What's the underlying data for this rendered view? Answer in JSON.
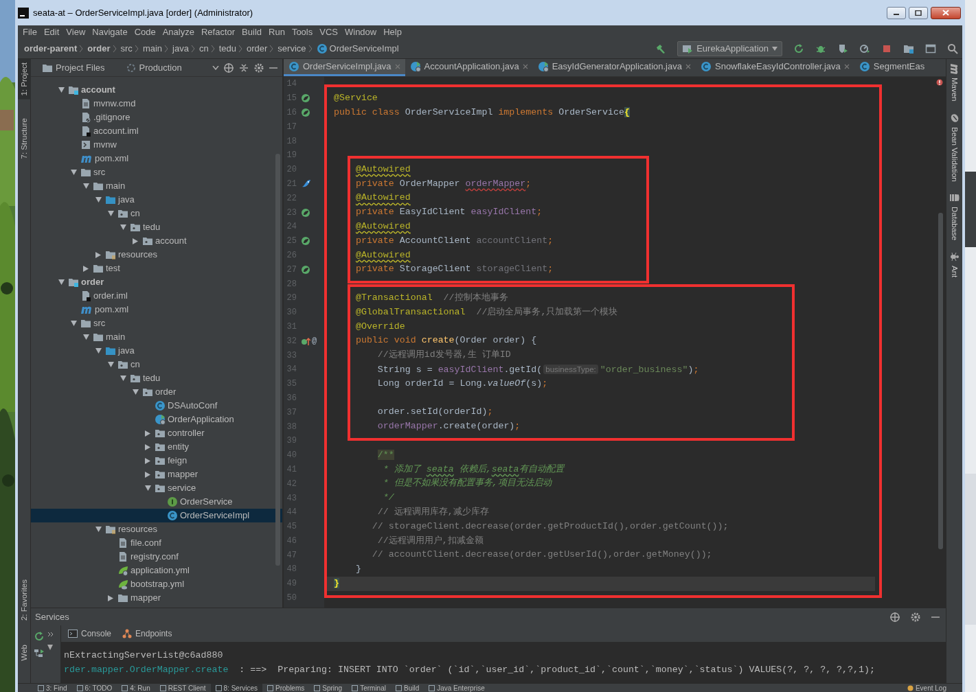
{
  "window": {
    "title": "seata-at – OrderServiceImpl.java [order] (Administrator)"
  },
  "menu": [
    "File",
    "Edit",
    "View",
    "Navigate",
    "Code",
    "Analyze",
    "Refactor",
    "Build",
    "Run",
    "Tools",
    "VCS",
    "Window",
    "Help"
  ],
  "breadcrumbs": [
    {
      "label": "order-parent",
      "kind": "module"
    },
    {
      "label": "order",
      "kind": "module"
    },
    {
      "label": "src",
      "kind": "folder"
    },
    {
      "label": "main",
      "kind": "folder"
    },
    {
      "label": "java",
      "kind": "folder"
    },
    {
      "label": "cn",
      "kind": "folder"
    },
    {
      "label": "tedu",
      "kind": "folder"
    },
    {
      "label": "order",
      "kind": "folder"
    },
    {
      "label": "service",
      "kind": "folder"
    },
    {
      "label": "OrderServiceImpl",
      "kind": "class"
    }
  ],
  "run_config": {
    "label": "EurekaApplication"
  },
  "left_strip": {
    "top": [
      {
        "label": "1: Project",
        "selected": true
      },
      {
        "label": "7: Structure",
        "selected": false
      }
    ],
    "bottom": [
      {
        "label": "2: Favorites",
        "selected": false
      },
      {
        "label": "Web",
        "selected": false
      }
    ]
  },
  "right_strip": [
    "Maven",
    "Bean Validation",
    "Database",
    "Ant"
  ],
  "project_panel": {
    "view": "Project Files",
    "scope": "Production",
    "tree": [
      {
        "label": "account",
        "kind": "module",
        "selected": false,
        "expanded": true,
        "children": [
          {
            "label": "mvnw.cmd",
            "kind": "file-text",
            "selected": false
          },
          {
            "label": ".gitignore",
            "kind": "file-ignore",
            "selected": false
          },
          {
            "label": "account.iml",
            "kind": "file-iml",
            "selected": false
          },
          {
            "label": "mvnw",
            "kind": "file-script",
            "selected": false
          },
          {
            "label": "pom.xml",
            "kind": "maven",
            "selected": false
          },
          {
            "label": "src",
            "kind": "folder",
            "selected": false,
            "expanded": true,
            "children": [
              {
                "label": "main",
                "kind": "folder",
                "selected": false,
                "expanded": true,
                "children": [
                  {
                    "label": "java",
                    "kind": "folder-src",
                    "selected": false,
                    "expanded": true,
                    "children": [
                      {
                        "label": "cn",
                        "kind": "package",
                        "selected": false,
                        "expanded": true,
                        "children": [
                          {
                            "label": "tedu",
                            "kind": "package",
                            "selected": false,
                            "expanded": true,
                            "children": [
                              {
                                "label": "account",
                                "kind": "package",
                                "selected": false,
                                "expanded": false
                              }
                            ]
                          }
                        ]
                      }
                    ]
                  },
                  {
                    "label": "resources",
                    "kind": "folder-res",
                    "selected": false,
                    "expanded": false
                  }
                ]
              },
              {
                "label": "test",
                "kind": "folder",
                "selected": false,
                "expanded": false
              }
            ]
          }
        ]
      },
      {
        "label": "order",
        "kind": "module",
        "selected": false,
        "expanded": true,
        "children": [
          {
            "label": "order.iml",
            "kind": "file-iml",
            "selected": false
          },
          {
            "label": "pom.xml",
            "kind": "maven",
            "selected": false
          },
          {
            "label": "src",
            "kind": "folder",
            "selected": false,
            "expanded": true,
            "children": [
              {
                "label": "main",
                "kind": "folder",
                "selected": false,
                "expanded": true,
                "children": [
                  {
                    "label": "java",
                    "kind": "folder-src",
                    "selected": false,
                    "expanded": true,
                    "children": [
                      {
                        "label": "cn",
                        "kind": "package",
                        "selected": false,
                        "expanded": true,
                        "children": [
                          {
                            "label": "tedu",
                            "kind": "package",
                            "selected": false,
                            "expanded": true,
                            "children": [
                              {
                                "label": "order",
                                "kind": "package",
                                "selected": false,
                                "expanded": true,
                                "children": [
                                  {
                                    "label": "DSAutoConf",
                                    "kind": "class",
                                    "selected": false
                                  },
                                  {
                                    "label": "OrderApplication",
                                    "kind": "class-app",
                                    "selected": false
                                  },
                                  {
                                    "label": "controller",
                                    "kind": "package",
                                    "selected": false,
                                    "expanded": false
                                  },
                                  {
                                    "label": "entity",
                                    "kind": "package",
                                    "selected": false,
                                    "expanded": false
                                  },
                                  {
                                    "label": "feign",
                                    "kind": "package",
                                    "selected": false,
                                    "expanded": false
                                  },
                                  {
                                    "label": "mapper",
                                    "kind": "package",
                                    "selected": false,
                                    "expanded": false
                                  },
                                  {
                                    "label": "service",
                                    "kind": "package",
                                    "selected": false,
                                    "expanded": true,
                                    "children": [
                                      {
                                        "label": "OrderService",
                                        "kind": "interface",
                                        "selected": false
                                      },
                                      {
                                        "label": "OrderServiceImpl",
                                        "kind": "class",
                                        "selected": true
                                      }
                                    ]
                                  }
                                ]
                              }
                            ]
                          }
                        ]
                      }
                    ]
                  },
                  {
                    "label": "resources",
                    "kind": "folder-res",
                    "selected": false,
                    "expanded": true,
                    "children": [
                      {
                        "label": "file.conf",
                        "kind": "file-text",
                        "selected": false
                      },
                      {
                        "label": "registry.conf",
                        "kind": "file-text",
                        "selected": false
                      },
                      {
                        "label": "application.yml",
                        "kind": "yml-app",
                        "selected": false
                      },
                      {
                        "label": "bootstrap.yml",
                        "kind": "yml",
                        "selected": false
                      },
                      {
                        "label": "mapper",
                        "kind": "folder",
                        "selected": false,
                        "expanded": false
                      }
                    ]
                  }
                ]
              }
            ]
          }
        ]
      }
    ]
  },
  "editor": {
    "tabs": [
      {
        "label": "OrderServiceImpl.java",
        "kind": "class",
        "selected": true,
        "closable": true
      },
      {
        "label": "AccountApplication.java",
        "kind": "class-app",
        "selected": false,
        "closable": true
      },
      {
        "label": "EasyIdGeneratorApplication.java",
        "kind": "class-app",
        "selected": false,
        "closable": true
      },
      {
        "label": "SnowflakeEasyIdController.java",
        "kind": "class",
        "selected": false,
        "closable": true
      },
      {
        "label": "SegmentEas",
        "kind": "class",
        "selected": false,
        "closable": false
      }
    ],
    "lines": [
      {
        "kind": "line",
        "number": "14"
      },
      {
        "kind": "frame",
        "lines": [
          {
            "kind": "line",
            "number": "15",
            "gutter": {
              "kind": "bean"
            },
            "tokens": [
              {
                "kind": "annotation",
                "text": "@Service"
              }
            ]
          },
          {
            "kind": "line",
            "number": "16",
            "gutter": {
              "kind": "bean"
            },
            "tokens": [
              {
                "kind": "keyword",
                "text": "public class "
              },
              {
                "kind": "plain",
                "text": "OrderServiceImpl "
              },
              {
                "kind": "keyword",
                "text": "implements "
              },
              {
                "kind": "plain",
                "text": "OrderService"
              },
              {
                "kind": "brace",
                "text": "{"
              }
            ]
          },
          {
            "kind": "line",
            "number": "17"
          },
          {
            "kind": "line",
            "number": "18"
          },
          {
            "kind": "line",
            "number": "19"
          },
          {
            "kind": "frame",
            "lines": [
              {
                "kind": "line",
                "number": "20",
                "tokens": [
                  {
                    "kind": "annotation",
                    "text": "    @Autowired",
                    "underlined": true
                  }
                ]
              },
              {
                "kind": "line",
                "number": "21",
                "gutter": {
                  "kind": "mapper"
                },
                "tokens": [
                  {
                    "kind": "keyword",
                    "text": "    private "
                  },
                  {
                    "kind": "plain",
                    "text": "OrderMapper "
                  },
                  {
                    "kind": "field",
                    "text": "orderMapper",
                    "underlined": true
                  },
                  {
                    "kind": "keyword",
                    "text": ";"
                  }
                ]
              },
              {
                "kind": "line",
                "number": "22",
                "tokens": [
                  {
                    "kind": "annotation",
                    "text": "    @Autowired",
                    "underlined": true
                  }
                ]
              },
              {
                "kind": "line",
                "number": "23",
                "gutter": {
                  "kind": "bean"
                },
                "tokens": [
                  {
                    "kind": "keyword",
                    "text": "    private "
                  },
                  {
                    "kind": "plain",
                    "text": "EasyIdClient "
                  },
                  {
                    "kind": "field",
                    "text": "easyIdClient"
                  },
                  {
                    "kind": "keyword",
                    "text": ";"
                  }
                ]
              },
              {
                "kind": "line",
                "number": "24",
                "tokens": [
                  {
                    "kind": "annotation",
                    "text": "    @Autowired",
                    "underlined": true
                  }
                ]
              },
              {
                "kind": "line",
                "number": "25",
                "gutter": {
                  "kind": "bean"
                },
                "tokens": [
                  {
                    "kind": "keyword",
                    "text": "    private "
                  },
                  {
                    "kind": "plain",
                    "text": "AccountClient "
                  },
                  {
                    "kind": "unused",
                    "text": "accountClient"
                  },
                  {
                    "kind": "keyword",
                    "text": ";"
                  }
                ]
              },
              {
                "kind": "line",
                "number": "26",
                "tokens": [
                  {
                    "kind": "annotation",
                    "text": "    @Autowired",
                    "underlined": true
                  }
                ]
              },
              {
                "kind": "line",
                "number": "27",
                "gutter": {
                  "kind": "bean"
                },
                "tokens": [
                  {
                    "kind": "keyword",
                    "text": "    private "
                  },
                  {
                    "kind": "plain",
                    "text": "StorageClient "
                  },
                  {
                    "kind": "unused",
                    "text": "storageClient"
                  },
                  {
                    "kind": "keyword",
                    "text": ";"
                  }
                ]
              }
            ]
          },
          {
            "kind": "line",
            "number": "28"
          },
          {
            "kind": "frame",
            "lines": [
              {
                "kind": "line",
                "number": "29",
                "tokens": [
                  {
                    "kind": "annotation",
                    "text": "    @Transactional"
                  },
                  {
                    "kind": "comment",
                    "text": "  //控制本地事务"
                  }
                ]
              },
              {
                "kind": "line",
                "number": "30",
                "tokens": [
                  {
                    "kind": "annotation",
                    "text": "    @GlobalTransactional"
                  },
                  {
                    "kind": "comment",
                    "text": "  //启动全局事务,只加载第一个模块"
                  }
                ]
              },
              {
                "kind": "line",
                "number": "31",
                "tokens": [
                  {
                    "kind": "annotation",
                    "text": "    @Override"
                  }
                ]
              },
              {
                "kind": "line",
                "number": "32",
                "gutter": {
                  "kind": "override",
                  "mark": "@"
                },
                "tokens": [
                  {
                    "kind": "keyword",
                    "text": "    public void "
                  },
                  {
                    "kind": "method",
                    "text": "create"
                  },
                  {
                    "kind": "plain",
                    "text": "(Order order) {"
                  }
                ]
              },
              {
                "kind": "line",
                "number": "33",
                "tokens": [
                  {
                    "kind": "comment",
                    "text": "        //远程调用id发号器,生 订单ID"
                  }
                ]
              },
              {
                "kind": "line",
                "number": "34",
                "tokens": [
                  {
                    "kind": "plain",
                    "text": "        String s = "
                  },
                  {
                    "kind": "field",
                    "text": "easyIdClient"
                  },
                  {
                    "kind": "plain",
                    "text": ".getId("
                  },
                  {
                    "kind": "hint",
                    "text": "businessType:"
                  },
                  {
                    "kind": "string",
                    "text": "\"order_business\""
                  },
                  {
                    "kind": "plain",
                    "text": ")"
                  },
                  {
                    "kind": "keyword",
                    "text": ";"
                  }
                ]
              },
              {
                "kind": "line",
                "number": "35",
                "tokens": [
                  {
                    "kind": "plain",
                    "text": "        Long orderId = Long."
                  },
                  {
                    "kind": "static",
                    "text": "valueOf"
                  },
                  {
                    "kind": "plain",
                    "text": "(s)"
                  },
                  {
                    "kind": "keyword",
                    "text": ";"
                  }
                ]
              },
              {
                "kind": "line",
                "number": "36"
              },
              {
                "kind": "line",
                "number": "37",
                "tokens": [
                  {
                    "kind": "plain",
                    "text": "        order.setId(orderId)"
                  },
                  {
                    "kind": "keyword",
                    "text": ";"
                  }
                ]
              },
              {
                "kind": "line",
                "number": "38",
                "tokens": [
                  {
                    "kind": "field",
                    "text": "        orderMapper"
                  },
                  {
                    "kind": "plain",
                    "text": ".create(order)"
                  },
                  {
                    "kind": "keyword",
                    "text": ";"
                  }
                ]
              }
            ]
          },
          {
            "kind": "line",
            "number": "39"
          },
          {
            "kind": "line",
            "number": "40",
            "tokens": [
              {
                "kind": "doc-open",
                "text": "        /**"
              }
            ]
          },
          {
            "kind": "line",
            "number": "41",
            "tokens": [
              {
                "kind": "doc",
                "text": "         * 添加了 "
              },
              {
                "kind": "doc",
                "text": "seata",
                "underlined": true
              },
              {
                "kind": "doc",
                "text": " 依赖后,"
              },
              {
                "kind": "doc",
                "text": "seata",
                "underlined": true
              },
              {
                "kind": "doc",
                "text": "有自动配置"
              }
            ]
          },
          {
            "kind": "line",
            "number": "42",
            "tokens": [
              {
                "kind": "doc",
                "text": "         * 但是不如果没有配置事务,项目无法启动"
              }
            ]
          },
          {
            "kind": "line",
            "number": "43",
            "tokens": [
              {
                "kind": "doc",
                "text": "         */"
              }
            ]
          },
          {
            "kind": "line",
            "number": "44",
            "tokens": [
              {
                "kind": "comment",
                "text": "        // 远程调用库存,减少库存"
              }
            ]
          },
          {
            "kind": "line",
            "number": "45",
            "tokens": [
              {
                "kind": "comment",
                "text": "       // storageClient.decrease(order.getProductId(),order.getCount());"
              }
            ]
          },
          {
            "kind": "line",
            "number": "46",
            "tokens": [
              {
                "kind": "comment",
                "text": "        //远程调用用户,扣减金额"
              }
            ]
          },
          {
            "kind": "line",
            "number": "47",
            "tokens": [
              {
                "kind": "comment",
                "text": "       // accountClient.decrease(order.getUserId(),order.getMoney());"
              }
            ]
          },
          {
            "kind": "line",
            "number": "48",
            "tokens": [
              {
                "kind": "plain",
                "text": "    }"
              }
            ]
          },
          {
            "kind": "line",
            "number": "49",
            "current": true,
            "tokens": [
              {
                "kind": "brace",
                "text": "}"
              }
            ]
          }
        ]
      },
      {
        "kind": "line",
        "number": "50"
      }
    ]
  },
  "services": {
    "title": "Services",
    "tabs": [
      {
        "label": "Console",
        "kind": "console"
      },
      {
        "label": "Endpoints",
        "kind": "endpoints"
      }
    ],
    "console": [
      [
        {
          "kind": "plain",
          "text": "nExtractingServerList@c6ad880"
        }
      ],
      [
        {
          "kind": "logger",
          "text": "rder.mapper.OrderMapper.create"
        },
        {
          "kind": "plain",
          "text": "  : ==>  Preparing: INSERT INTO `order` (`id`,`user_id`,`product_id`,`count`,`money`,`status`) VALUES(?, ?, ?, ?,?,1);"
        }
      ]
    ]
  },
  "bottom_bar": {
    "tools": [
      {
        "label": "3: Find",
        "selected": false
      },
      {
        "label": "6: TODO",
        "selected": false
      },
      {
        "label": "4: Run",
        "selected": false
      },
      {
        "label": "REST Client",
        "selected": false
      },
      {
        "label": "8: Services",
        "selected": true
      },
      {
        "label": "Problems",
        "selected": false
      },
      {
        "label": "Spring",
        "selected": false
      },
      {
        "label": "Terminal",
        "selected": false
      },
      {
        "label": "Build",
        "selected": false
      },
      {
        "label": "Java Enterprise",
        "selected": false
      }
    ],
    "event_log": "Event Log"
  }
}
